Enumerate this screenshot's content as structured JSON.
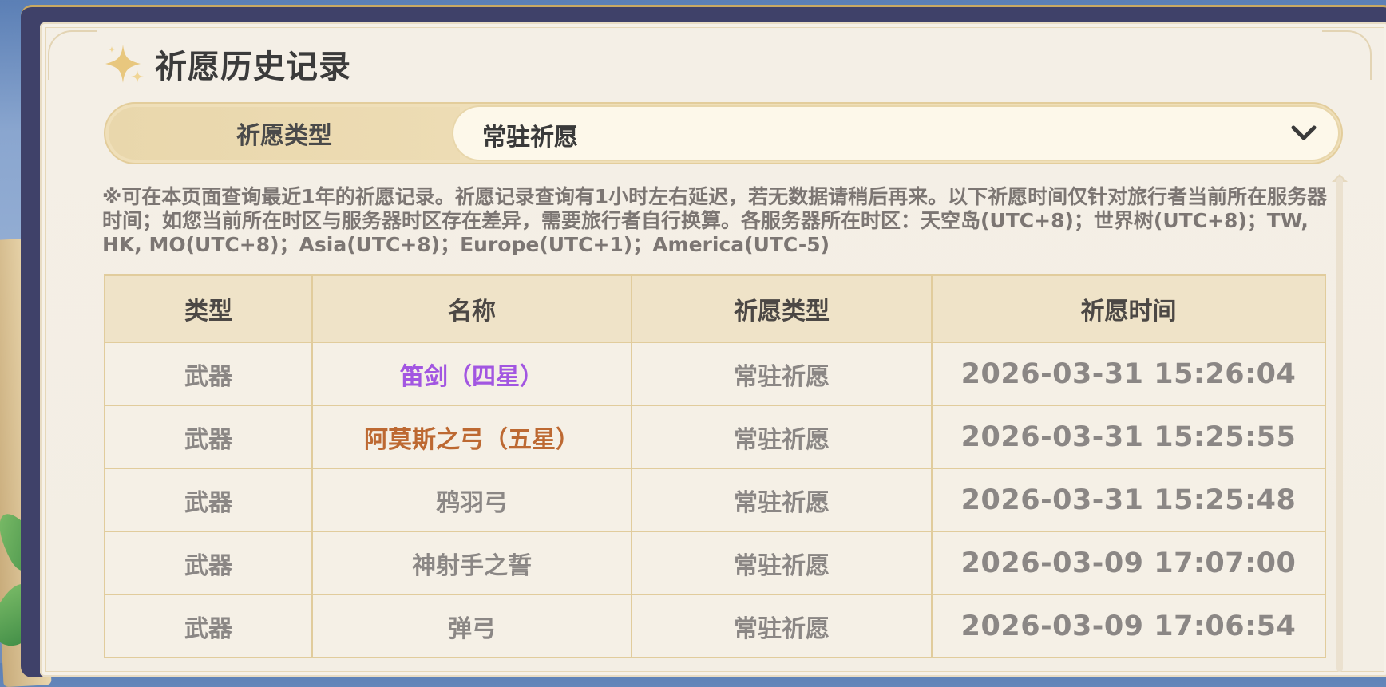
{
  "page_title": "祈愿历史记录",
  "filter": {
    "label": "祈愿类型",
    "selected": "常驻祈愿"
  },
  "notice": "※可在本页面查询最近1年的祈愿记录。祈愿记录查询有1小时左右延迟，若无数据请稍后再来。以下祈愿时间仅针对旅行者当前所在服务器时间；如您当前所在时区与服务器时区存在差异，需要旅行者自行换算。各服务器所在时区：天空岛(UTC+8)；世界树(UTC+8)；TW, HK, MO(UTC+8)；Asia(UTC+8)；Europe(UTC+1)；America(UTC-5)",
  "table": {
    "headers": [
      "类型",
      "名称",
      "祈愿类型",
      "祈愿时间"
    ],
    "rows": [
      {
        "type": "武器",
        "name": "笛剑（四星）",
        "wish_type": "常驻祈愿",
        "time": "2026-03-31 15:26:04",
        "color": "#a256e1"
      },
      {
        "type": "武器",
        "name": "阿莫斯之弓（五星）",
        "wish_type": "常驻祈愿",
        "time": "2026-03-31 15:25:55",
        "color": "#bd6932"
      },
      {
        "type": "武器",
        "name": "鸦羽弓",
        "wish_type": "常驻祈愿",
        "time": "2026-03-31 15:25:48",
        "color": "#8b8785"
      },
      {
        "type": "武器",
        "name": "神射手之誓",
        "wish_type": "常驻祈愿",
        "time": "2026-03-09 17:07:00",
        "color": "#8b8785"
      },
      {
        "type": "武器",
        "name": "弹弓",
        "wish_type": "常驻祈愿",
        "time": "2026-03-09 17:06:54",
        "color": "#8b8785"
      }
    ]
  },
  "colors": {
    "four_star": "#a256e1",
    "five_star": "#bd6932",
    "three_star": "#8b8785",
    "header_bg": "#efe3c8",
    "row_bg": "#f5f0e6"
  },
  "icons": {
    "title": "sparkle-star-icon",
    "dropdown": "chevron-down-icon"
  }
}
